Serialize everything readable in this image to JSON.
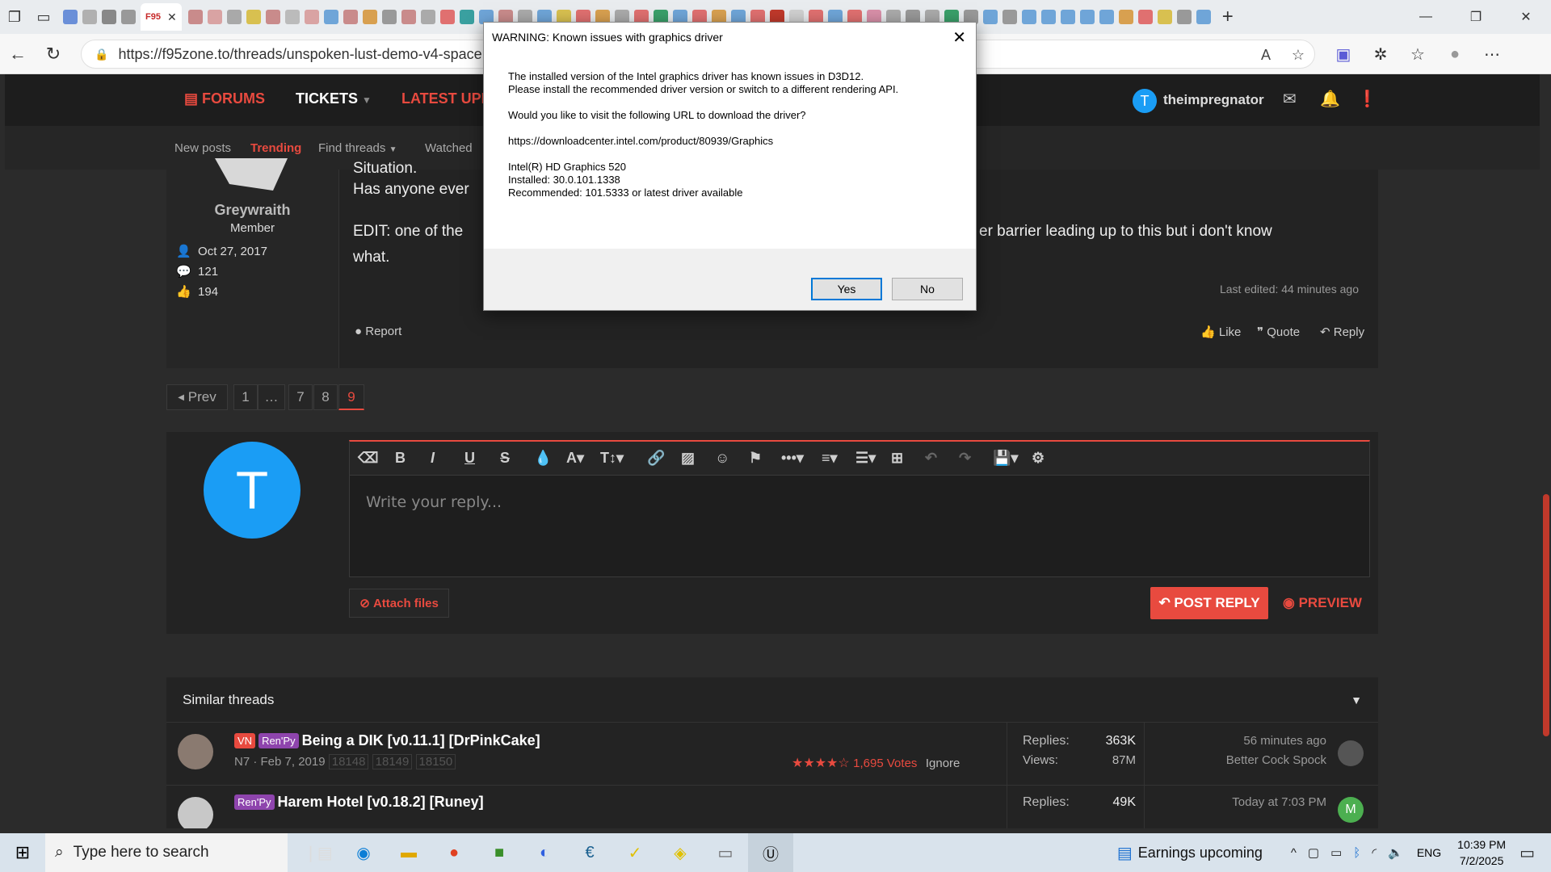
{
  "browser": {
    "url": "https://f95zone.to/threads/unspoken-lust-demo-v4-spaceh",
    "active_tab_label": "F95",
    "close_tab": "✕",
    "new_tab": "+"
  },
  "site": {
    "nav": {
      "forums": "FORUMS",
      "tickets": "TICKETS",
      "latest": "LATEST UPD",
      "username": "theimpregnator",
      "user_initial": "T"
    },
    "subnav": {
      "new_posts": "New posts",
      "trending": "Trending",
      "find_threads": "Find threads",
      "watched": "Watched"
    },
    "post": {
      "cut_text": "Situation.",
      "author": "Greywraith",
      "role": "Member",
      "joined": "Oct 27, 2017",
      "messages": "121",
      "reactions": "194",
      "line1": "Has anyone ever",
      "line2_start": "EDIT: one of the",
      "line2_end": "er barrier leading up to this but i don't know",
      "line3": "what.",
      "last_edited": "Last edited: 44 minutes ago",
      "report": "Report",
      "like": "Like",
      "quote": "Quote",
      "reply": "Reply"
    },
    "pagination": {
      "prev": "Prev",
      "pages": [
        "1",
        "…",
        "7",
        "8",
        "9"
      ]
    },
    "editor": {
      "placeholder": "Write your reply...",
      "attach": "Attach files",
      "post_reply": "POST REPLY",
      "preview": "PREVIEW"
    },
    "similar": {
      "heading": "Similar threads",
      "threads": [
        {
          "tags": [
            "VN",
            "Ren'Py"
          ],
          "title": "Being a DIK [v0.11.1] [DrPinkCake]",
          "meta": "N7 · Feb 7, 2019",
          "pages": [
            "18148",
            "18149",
            "18150"
          ],
          "votes": "1,695 Votes",
          "ignore": "Ignore",
          "replies_label": "Replies:",
          "replies": "363K",
          "views_label": "Views:",
          "views": "87M",
          "last_time": "56 minutes ago",
          "last_user": "Better Cock Spock"
        },
        {
          "tags": [
            "Ren'Py"
          ],
          "title": "Harem Hotel [v0.18.2] [Runey]",
          "replies_label": "Replies:",
          "replies": "49K",
          "last_time": "Today at 7:03 PM",
          "last_user_initial": "M"
        }
      ]
    }
  },
  "dialog": {
    "title": "WARNING: Known issues with graphics driver",
    "close": "✕",
    "lines": [
      "The installed version of the Intel graphics driver has known issues in D3D12.",
      "Please install the recommended driver version or switch to a different rendering API.",
      "Would you like to visit the following URL to download the driver?",
      "https://downloadcenter.intel.com/product/80939/Graphics",
      "Intel(R) HD Graphics 520",
      "Installed: 30.0.101.1338",
      "Recommended: 101.5333 or latest driver available"
    ],
    "yes": "Yes",
    "no": "No"
  },
  "taskbar": {
    "search_placeholder": "Type here to search",
    "news": "Earnings upcoming",
    "lang": "ENG",
    "time": "10:39 PM",
    "date": "7/2/2025"
  },
  "colors": {
    "accent": "#e84a3f",
    "avatar": "#1a9df5",
    "purple_tag": "#8e44ad"
  }
}
